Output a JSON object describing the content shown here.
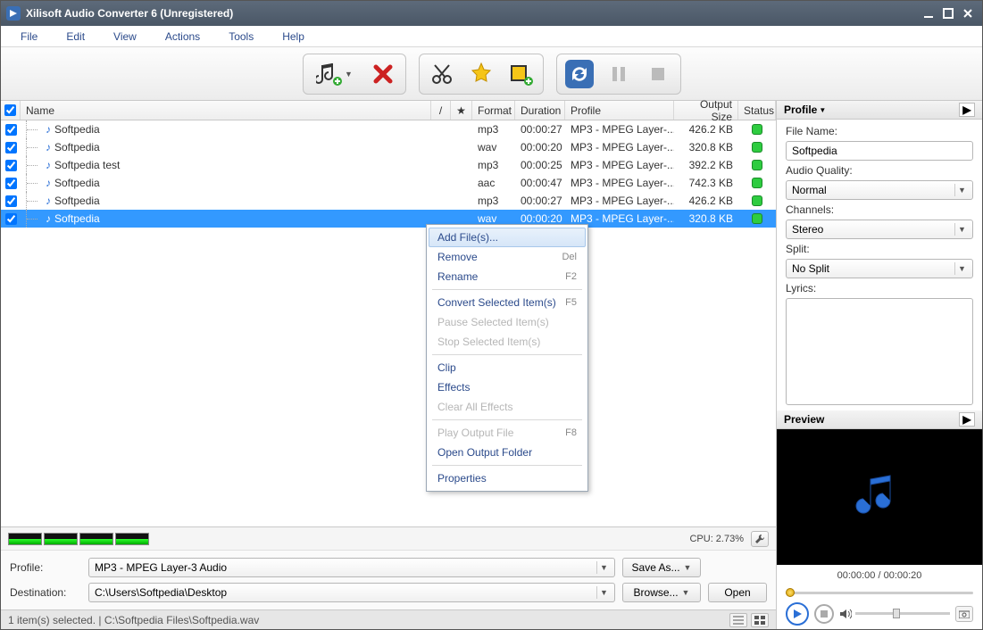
{
  "window": {
    "title": "Xilisoft Audio Converter 6 (Unregistered)"
  },
  "menu": [
    "File",
    "Edit",
    "View",
    "Actions",
    "Tools",
    "Help"
  ],
  "columns": {
    "name": "Name",
    "format": "Format",
    "duration": "Duration",
    "profile": "Profile",
    "output_size": "Output Size",
    "status": "Status"
  },
  "rows": [
    {
      "checked": true,
      "name": "Softpedia",
      "format": "mp3",
      "duration": "00:00:27",
      "profile": "MP3 - MPEG Layer-...",
      "size": "426.2 KB",
      "selected": false
    },
    {
      "checked": true,
      "name": "Softpedia",
      "format": "wav",
      "duration": "00:00:20",
      "profile": "MP3 - MPEG Layer-...",
      "size": "320.8 KB",
      "selected": false
    },
    {
      "checked": true,
      "name": "Softpedia test",
      "format": "mp3",
      "duration": "00:00:25",
      "profile": "MP3 - MPEG Layer-...",
      "size": "392.2 KB",
      "selected": false
    },
    {
      "checked": true,
      "name": "Softpedia",
      "format": "aac",
      "duration": "00:00:47",
      "profile": "MP3 - MPEG Layer-...",
      "size": "742.3 KB",
      "selected": false
    },
    {
      "checked": true,
      "name": "Softpedia",
      "format": "mp3",
      "duration": "00:00:27",
      "profile": "MP3 - MPEG Layer-...",
      "size": "426.2 KB",
      "selected": false
    },
    {
      "checked": true,
      "name": "Softpedia",
      "format": "wav",
      "duration": "00:00:20",
      "profile": "MP3 - MPEG Layer-...",
      "size": "320.8 KB",
      "selected": true
    }
  ],
  "context_menu": [
    {
      "label": "Add File(s)...",
      "shortcut": "",
      "disabled": false,
      "hover": true
    },
    {
      "label": "Remove",
      "shortcut": "Del",
      "disabled": false
    },
    {
      "label": "Rename",
      "shortcut": "F2",
      "disabled": false
    },
    {
      "sep": true
    },
    {
      "label": "Convert Selected Item(s)",
      "shortcut": "F5",
      "disabled": false
    },
    {
      "label": "Pause Selected Item(s)",
      "shortcut": "",
      "disabled": true
    },
    {
      "label": "Stop Selected Item(s)",
      "shortcut": "",
      "disabled": true
    },
    {
      "sep": true
    },
    {
      "label": "Clip",
      "shortcut": "",
      "disabled": false
    },
    {
      "label": "Effects",
      "shortcut": "",
      "disabled": false
    },
    {
      "label": "Clear All Effects",
      "shortcut": "",
      "disabled": true
    },
    {
      "sep": true
    },
    {
      "label": "Play Output File",
      "shortcut": "F8",
      "disabled": true
    },
    {
      "label": "Open Output Folder",
      "shortcut": "",
      "disabled": false
    },
    {
      "sep": true
    },
    {
      "label": "Properties",
      "shortcut": "",
      "disabled": false
    }
  ],
  "cpu": {
    "label": "CPU: 2.73%"
  },
  "profile_row": {
    "label": "Profile:",
    "value": "MP3 - MPEG Layer-3 Audio",
    "save_as": "Save As..."
  },
  "dest_row": {
    "label": "Destination:",
    "value": "C:\\Users\\Softpedia\\Desktop",
    "browse": "Browse...",
    "open": "Open"
  },
  "status": {
    "text": "1 item(s) selected. | C:\\Softpedia Files\\Softpedia.wav"
  },
  "side": {
    "header": "Profile",
    "filename_label": "File Name:",
    "filename": "Softpedia",
    "quality_label": "Audio Quality:",
    "quality": "Normal",
    "channels_label": "Channels:",
    "channels": "Stereo",
    "split_label": "Split:",
    "split": "No Split",
    "lyrics_label": "Lyrics:",
    "preview_header": "Preview",
    "time": "00:00:00 / 00:00:20"
  }
}
